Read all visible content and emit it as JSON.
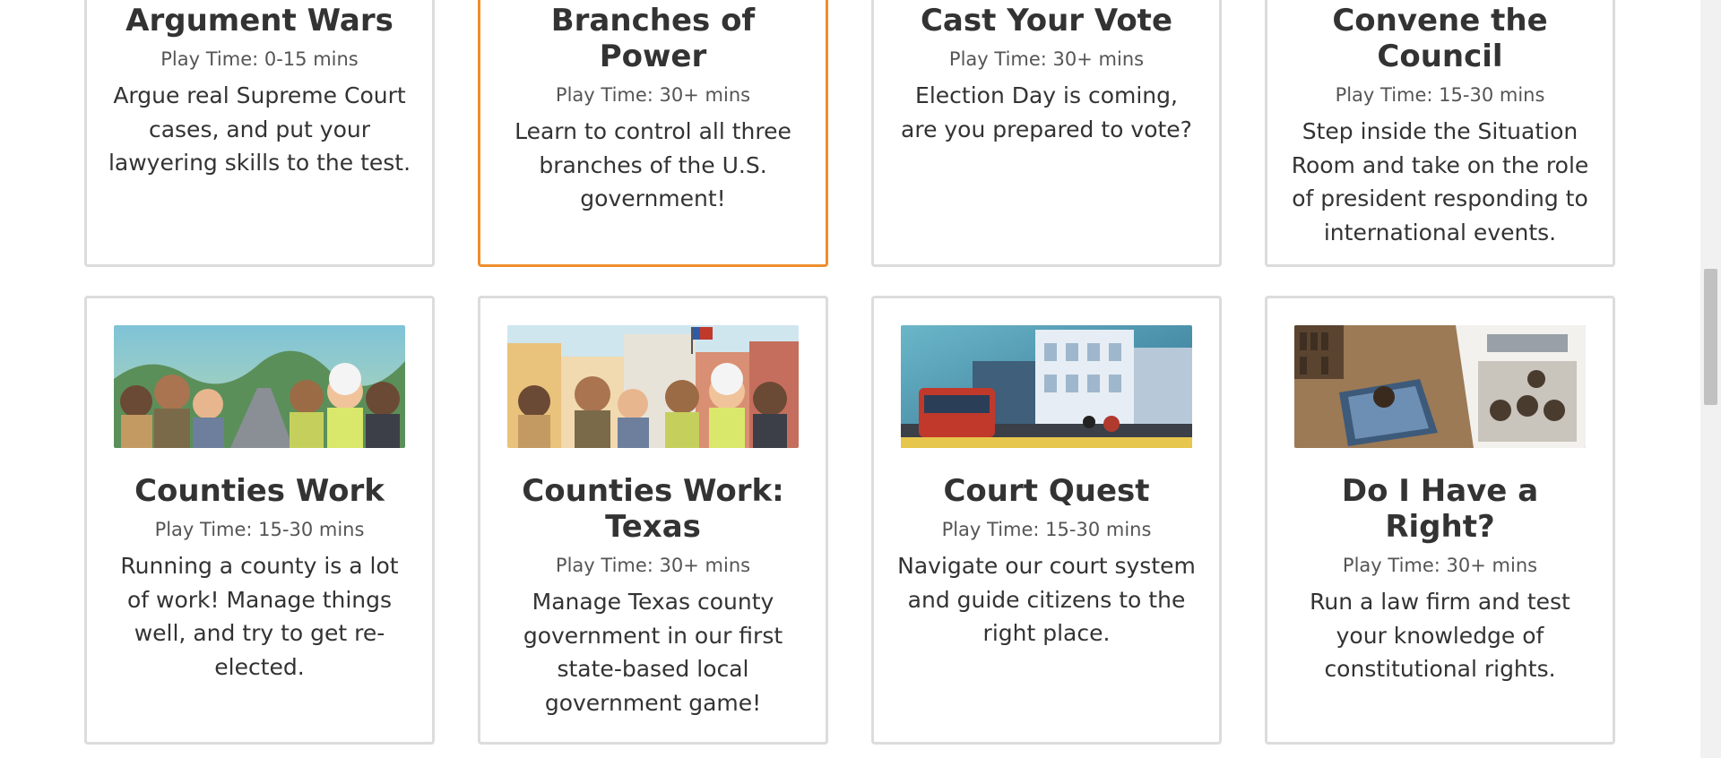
{
  "cards": [
    {
      "title": "Argument Wars",
      "play_time": "Play Time: 0-15 mins",
      "description": "Argue real Supreme Court cases, and put your lawyering skills to the test."
    },
    {
      "title": "Branches of Power",
      "play_time": "Play Time: 30+ mins",
      "description": "Learn to control all three branches of the U.S. government!"
    },
    {
      "title": "Cast Your Vote",
      "play_time": "Play Time: 30+ mins",
      "description": "Election Day is coming, are you prepared to vote?"
    },
    {
      "title": "Convene the Council",
      "play_time": "Play Time: 15-30 mins",
      "description": "Step inside the Situation Room and take on the role of president responding to international events."
    },
    {
      "title": "Counties Work",
      "play_time": "Play Time: 15-30 mins",
      "description": "Running a county is a lot of work! Manage things well, and try to get re-elected."
    },
    {
      "title": "Counties Work: Texas",
      "play_time": "Play Time: 30+ mins",
      "description": "Manage Texas county government in our first state-based local government game!"
    },
    {
      "title": "Court Quest",
      "play_time": "Play Time: 15-30 mins",
      "description": "Navigate our court system and guide citizens to the right place."
    },
    {
      "title": "Do I Have a Right?",
      "play_time": "Play Time: 30+ mins",
      "description": "Run a law firm and test your knowledge of constitutional rights."
    }
  ],
  "colors": {
    "active_border": "#ee8e2c",
    "card_border": "#dcdcdc"
  }
}
